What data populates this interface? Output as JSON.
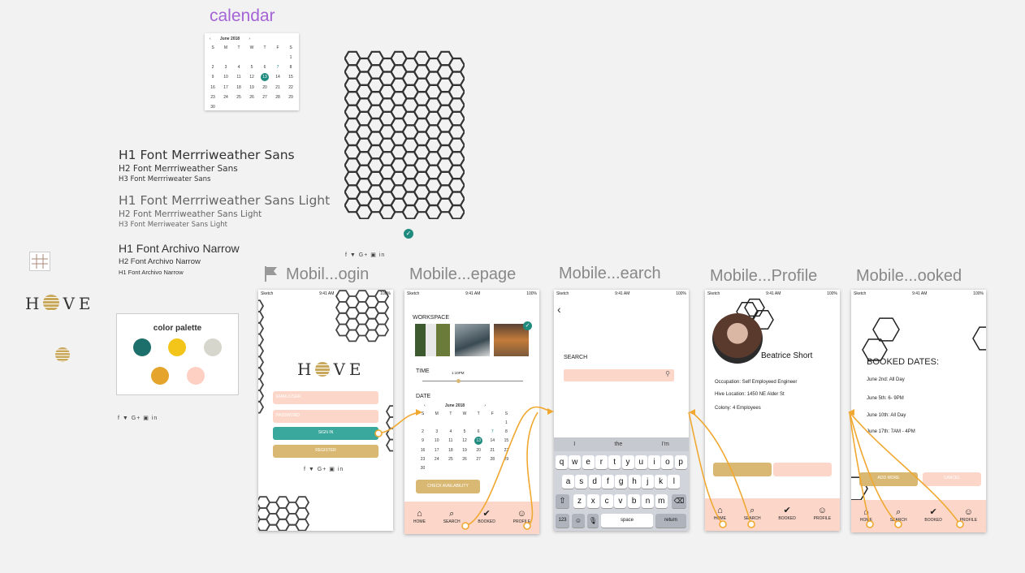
{
  "calendar_section": {
    "title": "calendar",
    "month": "June 2018",
    "weekdays": [
      "S",
      "M",
      "T",
      "W",
      "T",
      "F",
      "S"
    ],
    "days": [
      "",
      "",
      "",
      "",
      "",
      "",
      "1",
      "2",
      "3",
      "4",
      "5",
      "6",
      "7",
      "8",
      "9",
      "10",
      "11",
      "12",
      "13",
      "14",
      "15",
      "16",
      "17",
      "18",
      "19",
      "20",
      "21",
      "22",
      "23",
      "24",
      "25",
      "26",
      "27",
      "28",
      "29",
      "30",
      "",
      "",
      "",
      "",
      "",
      ""
    ],
    "selected_day": "13",
    "highlight_day": "7"
  },
  "typography": {
    "merri_h1": "H1 Font Merrriweather Sans",
    "merri_h2": "H2 Font Merrriweather Sans",
    "merri_h3": "H3 Font Merrriweater Sans",
    "light_h1": "H1 Font Merrriweather Sans Light",
    "light_h2": "H2 Font Merrriweather Sans Light",
    "light_h3": "H3 Font Merriweater Sans Light",
    "archivo_h1": "H1 Font Archivo Narrow",
    "archivo_h2": "H2 Font Archivo Narrow",
    "archivo_h3": "H1 Font Archivo Narrow"
  },
  "social_icons": "f  ▼  G+  ▣  in",
  "logo": {
    "left": "H",
    "right": "VE"
  },
  "palette": {
    "title": "color palette",
    "colors": [
      "#1d6f6b",
      "#f3c51b",
      "#d7d6cc",
      "#e5a52c",
      "#fdd0c3"
    ]
  },
  "artboards": {
    "login": "Mobil...ogin",
    "homepage": "Mobile...epage",
    "search": "Mobile...earch",
    "profile": "Mobile...Profile",
    "booked": "Mobile...ooked"
  },
  "status": {
    "carrier": "Sketch",
    "time": "9:41 AM",
    "battery": "100%"
  },
  "login_screen": {
    "email_placeholder": "EMAIL/USER",
    "password_placeholder": "PASSWORD",
    "signin": "SIGN IN",
    "register": "REGISTER"
  },
  "home_screen": {
    "workspace_label": "WORKSPACE",
    "time_label": "TIME",
    "time_value": "1:10PM",
    "date_label": "DATE",
    "check_button": "CHECK AVAILABILITY"
  },
  "search_screen": {
    "search_label": "SEARCH",
    "suggestions": [
      "I",
      "the",
      "I'm"
    ],
    "row1": [
      "q",
      "w",
      "e",
      "r",
      "t",
      "y",
      "u",
      "i",
      "o",
      "p"
    ],
    "row2": [
      "a",
      "s",
      "d",
      "f",
      "g",
      "h",
      "j",
      "k",
      "l"
    ],
    "row3": [
      "z",
      "x",
      "c",
      "v",
      "b",
      "n",
      "m"
    ],
    "num_key": "123",
    "space_key": "space",
    "return_key": "return"
  },
  "profile_screen": {
    "name": "Beatrice Short",
    "occupation": "Occupation: Self Employeed Engineer",
    "location": "Hive Location: 1450 NE Alder St",
    "colony": "Colony: 4 Employees"
  },
  "booked_screen": {
    "title": "BOOKED DATES:",
    "dates": [
      "June 2nd: All Day",
      "June 5th: 6- 9PM",
      "June 10th: All Day",
      "June 17th: 7AM - 4PM"
    ],
    "add_more": "ADD MORE",
    "cancel": "CANCEL"
  },
  "tabs": [
    "HOME",
    "SEARCH",
    "BOOKED",
    "PROFILE"
  ]
}
